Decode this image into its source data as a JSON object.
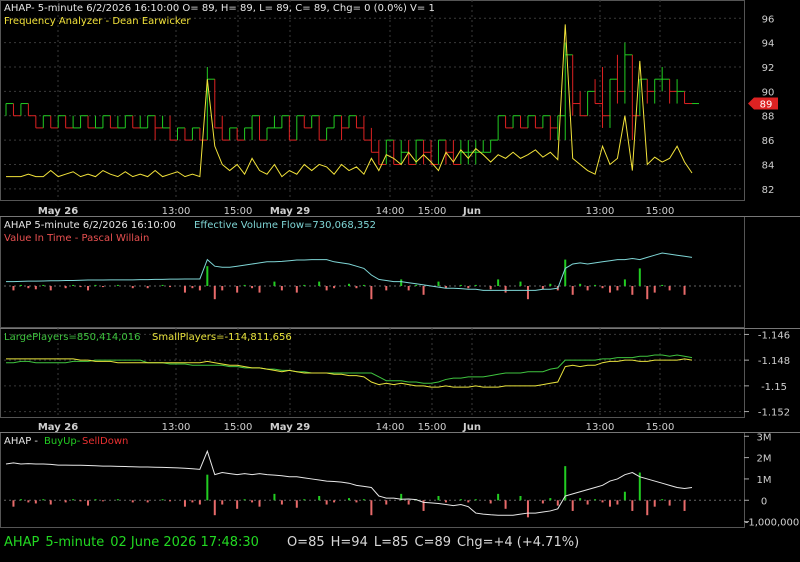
{
  "colors": {
    "up": "#22cc22",
    "down": "#dd2222",
    "analyzer": "#f2e23a",
    "white": "#e8e8e8",
    "cyan": "#7fd6d6",
    "green": "#3fc43f",
    "yellow": "#e8e23c",
    "grid": "#3a3a3a",
    "axisText": "#cfcfcf",
    "statusGreen": "#22d822",
    "statusGray": "#d8d8d8"
  },
  "panel1": {
    "header_line1": "AHAP- 5-minute 6/2/2026 16:10:00 O= 89, H= 89, L= 89, C= 89, Chg= 0 (0.0%) V= 1",
    "header_line2": "Frequency Analyzer - Dean Earwicker",
    "last_price_tag": "89"
  },
  "panel2": {
    "header_a": "AHAP 5-minute  6/2/2026 16:10:00",
    "header_b": "Effective Volume Flow=730,068,352",
    "header_line2": "Value In Time - Pascal Willain"
  },
  "panel3": {
    "label_large": "LargePlayers=850,414,016",
    "label_small": "SmallPlayers=-114,811,656"
  },
  "panel4": {
    "label_prefix": "AHAP - ",
    "label_up": "BuyUp-",
    "label_down": "SellDown"
  },
  "status": {
    "symbol": "AHAP",
    "interval": "5-minute",
    "datetime": "02 June 2026 17:48:30",
    "open": "O=85",
    "high": "H=94",
    "low": "L=85",
    "close": "C=89",
    "change": "Chg=+4 (+4.71%)"
  },
  "chart_data": [
    {
      "type": "line",
      "name": "price",
      "y_ticks": [
        "82",
        "84",
        "86",
        "88",
        "90",
        "92",
        "94",
        "96"
      ],
      "ylim": [
        81,
        97.5
      ],
      "x_ticks": [
        "May 26",
        "13:00",
        "15:00",
        "May 29",
        "14:00",
        "15:00",
        "Jun",
        "13:00",
        "15:00"
      ],
      "bars": [
        [
          89,
          89,
          88,
          89
        ],
        [
          89,
          89,
          88,
          88
        ],
        [
          88,
          89,
          88,
          89
        ],
        [
          89,
          89,
          88,
          88
        ],
        [
          88,
          88,
          87,
          87
        ],
        [
          87,
          88,
          87,
          88
        ],
        [
          88,
          88,
          87,
          87
        ],
        [
          87,
          88,
          87,
          88
        ],
        [
          88,
          88,
          87,
          87
        ],
        [
          87,
          88,
          87,
          87
        ],
        [
          87,
          88,
          87,
          88
        ],
        [
          88,
          88,
          87,
          87
        ],
        [
          87,
          88,
          87,
          87
        ],
        [
          87,
          88,
          87,
          88
        ],
        [
          88,
          88,
          87,
          87
        ],
        [
          87,
          88,
          87,
          87
        ],
        [
          87,
          88,
          87,
          88
        ],
        [
          88,
          88,
          87,
          87
        ],
        [
          87,
          88,
          87,
          87
        ],
        [
          87,
          88,
          87,
          88
        ],
        [
          88,
          88,
          86,
          87
        ],
        [
          87,
          88,
          87,
          87
        ],
        [
          87,
          88,
          86,
          86
        ],
        [
          86,
          87,
          86,
          87
        ],
        [
          87,
          87,
          86,
          86
        ],
        [
          86,
          87,
          86,
          87
        ],
        [
          87,
          87,
          86,
          86
        ],
        [
          86,
          92,
          86,
          91
        ],
        [
          91,
          91,
          87,
          87
        ],
        [
          87,
          88,
          86,
          86
        ],
        [
          86,
          87,
          86,
          87
        ],
        [
          87,
          87,
          86,
          86
        ],
        [
          86,
          87,
          86,
          87
        ],
        [
          87,
          88,
          86,
          88
        ],
        [
          88,
          88,
          86,
          86
        ],
        [
          86,
          87,
          86,
          87
        ],
        [
          87,
          88,
          87,
          87
        ],
        [
          87,
          88,
          87,
          88
        ],
        [
          88,
          88,
          86,
          86
        ],
        [
          86,
          88,
          86,
          88
        ],
        [
          88,
          88,
          87,
          87
        ],
        [
          87,
          88,
          87,
          88
        ],
        [
          88,
          88,
          86,
          86
        ],
        [
          86,
          87,
          86,
          87
        ],
        [
          87,
          88,
          87,
          88
        ],
        [
          88,
          88,
          86,
          87
        ],
        [
          87,
          88,
          87,
          88
        ],
        [
          88,
          88,
          87,
          87
        ],
        [
          87,
          88,
          86,
          86
        ],
        [
          86,
          87,
          85,
          85
        ],
        [
          85,
          86,
          84,
          84
        ],
        [
          84,
          86,
          84,
          86
        ],
        [
          86,
          86,
          84,
          84
        ],
        [
          84,
          86,
          84,
          85
        ],
        [
          85,
          86,
          84,
          84
        ],
        [
          84,
          86,
          84,
          86
        ],
        [
          86,
          86,
          84,
          85
        ],
        [
          85,
          86,
          84,
          84
        ],
        [
          84,
          86,
          84,
          86
        ],
        [
          86,
          86,
          84,
          85
        ],
        [
          85,
          86,
          84,
          84
        ],
        [
          84,
          86,
          84,
          85
        ],
        [
          85,
          86,
          84,
          85
        ],
        [
          85,
          86,
          84,
          85
        ],
        [
          85,
          86,
          85,
          85
        ],
        [
          85,
          86,
          85,
          86
        ],
        [
          86,
          88,
          86,
          88
        ],
        [
          88,
          88,
          87,
          87
        ],
        [
          87,
          88,
          87,
          88
        ],
        [
          88,
          88,
          87,
          87
        ],
        [
          87,
          88,
          87,
          88
        ],
        [
          88,
          88,
          87,
          87
        ],
        [
          87,
          88,
          87,
          88
        ],
        [
          88,
          88,
          86,
          87
        ],
        [
          87,
          88,
          86,
          88
        ],
        [
          88,
          94,
          86,
          93
        ],
        [
          93,
          93,
          88,
          89
        ],
        [
          89,
          90,
          88,
          88
        ],
        [
          88,
          90,
          88,
          90
        ],
        [
          90,
          91,
          89,
          89
        ],
        [
          89,
          92,
          87,
          88
        ],
        [
          88,
          91,
          87,
          91
        ],
        [
          91,
          93,
          89,
          90
        ],
        [
          90,
          94,
          89,
          93
        ],
        [
          93,
          93,
          86,
          88
        ],
        [
          88,
          91,
          88,
          91
        ],
        [
          91,
          91,
          89,
          90
        ],
        [
          90,
          91,
          89,
          91
        ],
        [
          91,
          92,
          90,
          91
        ],
        [
          91,
          91,
          89,
          90
        ],
        [
          90,
          91,
          89,
          90
        ],
        [
          90,
          90,
          89,
          89
        ],
        [
          89,
          89,
          89,
          89
        ]
      ],
      "analyzer": [
        83,
        83,
        83,
        83.2,
        83,
        83,
        83.5,
        83,
        83.2,
        83.4,
        83,
        83.2,
        83,
        83.5,
        83.2,
        83,
        83.4,
        83,
        83.2,
        83,
        83.5,
        83,
        83.2,
        83.4,
        83,
        83.2,
        83,
        91,
        85.5,
        84,
        83.5,
        84,
        83.2,
        84.5,
        83.5,
        83.2,
        84,
        83,
        83.5,
        83.2,
        84,
        83.5,
        84,
        83.8,
        83.2,
        84,
        83.5,
        83.8,
        83.2,
        84.5,
        83.5,
        84.8,
        84.5,
        84,
        85,
        84.2,
        84.8,
        84.2,
        83.5,
        85,
        84.2,
        85.2,
        84.5,
        85.3,
        84.8,
        84.2,
        84.8,
        84.5,
        85,
        84.5,
        84.8,
        85.2,
        84.6,
        85,
        84.4,
        95.5,
        84.5,
        84,
        83.5,
        83.2,
        85.5,
        84,
        84.5,
        88,
        83.5,
        92.5,
        84,
        84.6,
        84.2,
        84.5,
        85.5,
        84.2,
        83.3
      ]
    },
    {
      "type": "line",
      "name": "Effective Volume Flow",
      "buyup_ticks": [
        "3M",
        "2M",
        "1M",
        "0",
        "-1,000,000"
      ],
      "evf": [
        0.2,
        0.2,
        0.21,
        0.22,
        0.22,
        0.23,
        0.24,
        0.24,
        0.25,
        0.25,
        0.26,
        0.27,
        0.27,
        0.27,
        0.28,
        0.28,
        0.28,
        0.28,
        0.29,
        0.29,
        0.3,
        0.3,
        0.31,
        0.31,
        0.32,
        0.32,
        0.32,
        1.2,
        0.9,
        0.85,
        0.85,
        0.9,
        0.95,
        1.0,
        1.05,
        1.1,
        1.1,
        1.12,
        1.15,
        1.18,
        1.18,
        1.2,
        1.2,
        1.2,
        1.1,
        1.05,
        1.0,
        0.9,
        0.8,
        0.5,
        0.3,
        0.25,
        0.2,
        0.2,
        0.15,
        0.1,
        0.05,
        0.0,
        -0.05,
        -0.1,
        -0.1,
        -0.12,
        -0.15,
        -0.15,
        -0.2,
        -0.2,
        -0.2,
        -0.2,
        -0.2,
        -0.2,
        -0.2,
        -0.2,
        -0.15,
        -0.15,
        -0.1,
        0.8,
        1.0,
        1.05,
        1.0,
        1.05,
        1.1,
        1.15,
        1.2,
        1.2,
        1.25,
        1.2,
        1.3,
        1.4,
        1.5,
        1.45,
        1.4,
        1.35,
        1.3
      ],
      "vit_bars": [
        0,
        -0.2,
        0.05,
        -0.1,
        -0.15,
        0.05,
        -0.2,
        0,
        -0.1,
        0.05,
        -0.05,
        -0.2,
        0.05,
        -0.05,
        0,
        0.05,
        0,
        -0.1,
        0,
        -0.1,
        0,
        0.05,
        -0.05,
        0,
        -0.3,
        -0.1,
        -0.2,
        0.9,
        -0.6,
        -0.2,
        0,
        -0.3,
        0.05,
        -0.1,
        -0.3,
        0,
        0.2,
        -0.2,
        0,
        -0.3,
        0.05,
        0,
        0.2,
        -0.2,
        -0.1,
        0,
        0.1,
        -0.1,
        0.05,
        -0.6,
        0,
        -0.2,
        0,
        0.3,
        -0.2,
        0.05,
        -0.4,
        0,
        0.2,
        -0.1,
        0,
        0.05,
        -0.1,
        0.05,
        0,
        -0.15,
        0.3,
        -0.3,
        0,
        0.2,
        -0.6,
        0,
        -0.15,
        0.1,
        -0.2,
        1.2,
        -0.4,
        0.1,
        -0.2,
        0.05,
        -0.1,
        -0.3,
        -0.2,
        0.3,
        -0.4,
        0.8,
        -0.6,
        -0.3,
        0.05,
        -0.2,
        0,
        -0.4,
        0
      ]
    },
    {
      "type": "line",
      "name": "Large/Small Players",
      "y_ticks": [
        "-1.146",
        "-1.148",
        "-1.15",
        "-1.152"
      ],
      "ylim": [
        -1.1525,
        -1.1455
      ],
      "large": [
        -1.1482,
        -1.1482,
        -1.1481,
        -1.1481,
        -1.1482,
        -1.1482,
        -1.1482,
        -1.1482,
        -1.1482,
        -1.1481,
        -1.1481,
        -1.1481,
        -1.148,
        -1.148,
        -1.148,
        -1.148,
        -1.148,
        -1.148,
        -1.148,
        -1.1482,
        -1.1482,
        -1.1482,
        -1.1483,
        -1.1483,
        -1.1483,
        -1.1484,
        -1.1484,
        -1.1484,
        -1.1484,
        -1.1484,
        -1.1485,
        -1.1485,
        -1.1486,
        -1.1486,
        -1.1486,
        -1.1487,
        -1.1487,
        -1.1488,
        -1.1488,
        -1.1489,
        -1.1489,
        -1.149,
        -1.149,
        -1.149,
        -1.149,
        -1.149,
        -1.149,
        -1.149,
        -1.149,
        -1.149,
        -1.1493,
        -1.1496,
        -1.1496,
        -1.1496,
        -1.1497,
        -1.1497,
        -1.1498,
        -1.1498,
        -1.1497,
        -1.1495,
        -1.1494,
        -1.1494,
        -1.1493,
        -1.1493,
        -1.1493,
        -1.1492,
        -1.1491,
        -1.149,
        -1.149,
        -1.149,
        -1.1489,
        -1.1489,
        -1.1489,
        -1.1487,
        -1.1486,
        -1.148,
        -1.148,
        -1.148,
        -1.148,
        -1.148,
        -1.1479,
        -1.1479,
        -1.1478,
        -1.1478,
        -1.1478,
        -1.1477,
        -1.1477,
        -1.1476,
        -1.1476,
        -1.1477,
        -1.1476,
        -1.1477,
        -1.1478
      ],
      "small": [
        -1.1479,
        -1.1479,
        -1.1479,
        -1.1479,
        -1.1479,
        -1.1479,
        -1.1479,
        -1.1479,
        -1.1479,
        -1.1479,
        -1.148,
        -1.148,
        -1.1481,
        -1.1481,
        -1.1481,
        -1.1482,
        -1.1482,
        -1.1482,
        -1.1482,
        -1.1482,
        -1.1482,
        -1.1482,
        -1.1482,
        -1.1482,
        -1.1482,
        -1.1482,
        -1.1482,
        -1.1481,
        -1.1482,
        -1.1483,
        -1.1484,
        -1.1484,
        -1.1485,
        -1.1486,
        -1.1486,
        -1.1487,
        -1.1488,
        -1.1489,
        -1.1488,
        -1.1489,
        -1.149,
        -1.149,
        -1.149,
        -1.149,
        -1.1491,
        -1.1491,
        -1.1492,
        -1.1492,
        -1.1493,
        -1.1497,
        -1.1499,
        -1.1498,
        -1.1499,
        -1.1498,
        -1.1499,
        -1.15,
        -1.15,
        -1.1501,
        -1.1501,
        -1.15,
        -1.1501,
        -1.1501,
        -1.1501,
        -1.15,
        -1.1501,
        -1.1501,
        -1.1501,
        -1.15,
        -1.15,
        -1.15,
        -1.15,
        -1.15,
        -1.1499,
        -1.1498,
        -1.1497,
        -1.1485,
        -1.1484,
        -1.1485,
        -1.1484,
        -1.1484,
        -1.1482,
        -1.1481,
        -1.1481,
        -1.148,
        -1.148,
        -1.1481,
        -1.1481,
        -1.148,
        -1.148,
        -1.148,
        -1.148,
        -1.1479,
        -1.148
      ]
    },
    {
      "type": "line",
      "name": "BuyUp-SellDown",
      "ylim": [
        -1300000,
        3200000
      ],
      "line": [
        1700000,
        1750000,
        1700000,
        1720000,
        1700000,
        1700000,
        1680000,
        1650000,
        1650000,
        1640000,
        1640000,
        1630000,
        1620000,
        1600000,
        1600000,
        1590000,
        1580000,
        1570000,
        1560000,
        1560000,
        1550000,
        1540000,
        1530000,
        1520000,
        1500000,
        1480000,
        1450000,
        2300000,
        1200000,
        1300000,
        1250000,
        1200000,
        1250000,
        1200000,
        1250000,
        1200000,
        1180000,
        1150000,
        1100000,
        1100000,
        1050000,
        1000000,
        950000,
        900000,
        880000,
        850000,
        800000,
        700000,
        650000,
        600000,
        200000,
        100000,
        100000,
        50000,
        60000,
        30000,
        -100000,
        -120000,
        -150000,
        -200000,
        -250000,
        -200000,
        -300000,
        -600000,
        -650000,
        -680000,
        -700000,
        -700000,
        -700000,
        -650000,
        -600000,
        -600000,
        -550000,
        -500000,
        -400000,
        200000,
        300000,
        400000,
        500000,
        600000,
        700000,
        900000,
        1000000,
        1200000,
        1300000,
        1100000,
        1000000,
        900000,
        800000,
        700000,
        600000,
        550000,
        600000
      ],
      "bars": [
        0,
        -300000,
        50000,
        -100000,
        -150000,
        50000,
        -200000,
        0,
        -100000,
        50000,
        -50000,
        -250000,
        50000,
        -50000,
        0,
        50000,
        0,
        -100000,
        0,
        -100000,
        0,
        50000,
        -50000,
        0,
        -300000,
        -100000,
        -200000,
        1200000,
        -700000,
        -200000,
        0,
        -400000,
        50000,
        -100000,
        -300000,
        0,
        300000,
        -200000,
        0,
        -350000,
        50000,
        0,
        200000,
        -200000,
        -100000,
        0,
        100000,
        -100000,
        50000,
        -700000,
        0,
        -200000,
        0,
        300000,
        -200000,
        50000,
        -500000,
        0,
        200000,
        -100000,
        0,
        50000,
        -100000,
        50000,
        0,
        -150000,
        300000,
        -400000,
        0,
        200000,
        -800000,
        0,
        -150000,
        100000,
        -250000,
        1600000,
        -500000,
        100000,
        -200000,
        50000,
        -100000,
        -300000,
        -200000,
        400000,
        -500000,
        1300000,
        -700000,
        -300000,
        50000,
        -250000,
        0,
        -500000,
        0
      ]
    }
  ]
}
